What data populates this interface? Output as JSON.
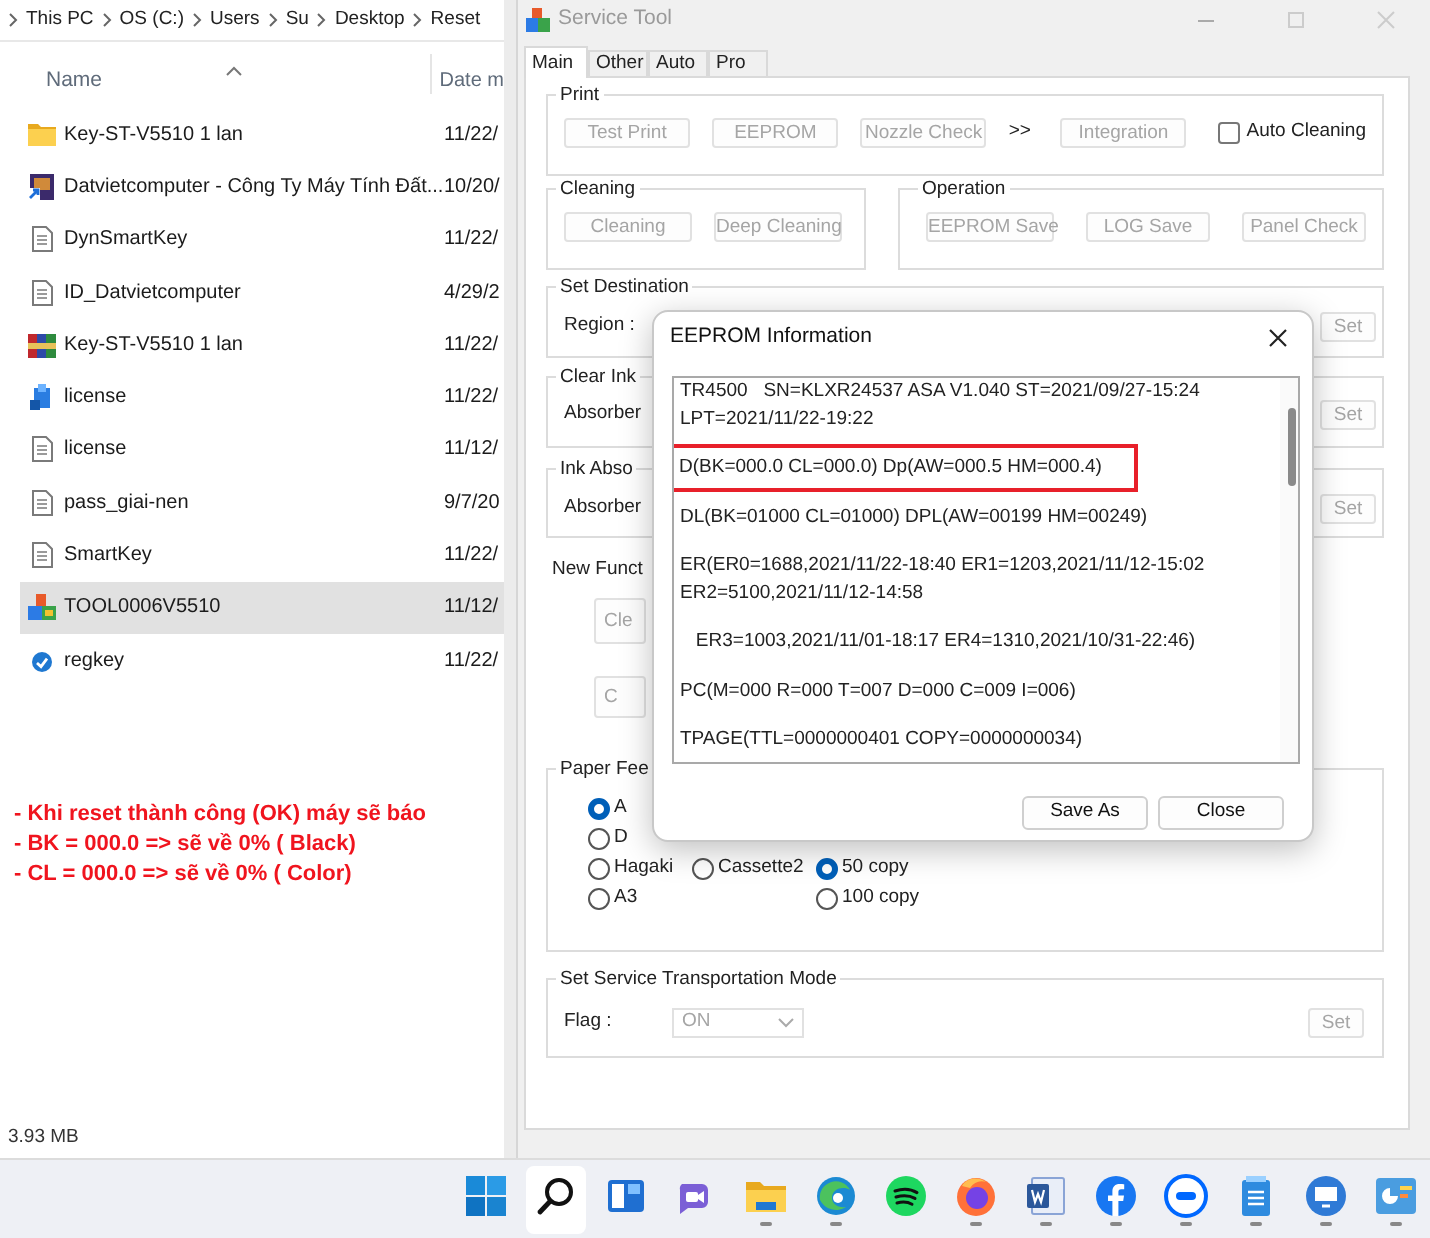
{
  "explorer": {
    "breadcrumb": [
      "This PC",
      "OS (C:)",
      "Users",
      "Su",
      "Desktop",
      "Reset"
    ],
    "columns": [
      "Name",
      "Date m"
    ],
    "files": [
      {
        "name": "Key-ST-V5510 1 lan",
        "date": "11/22/",
        "kind": "folder",
        "selected": false
      },
      {
        "name": "Datvietcomputer - Công Ty Máy Tính Đất...",
        "date": "10/20/",
        "kind": "shortcut",
        "selected": false
      },
      {
        "name": "DynSmartKey",
        "date": "11/22/",
        "kind": "text",
        "selected": false
      },
      {
        "name": "ID_Datvietcomputer",
        "date": "4/29/2",
        "kind": "text",
        "selected": false
      },
      {
        "name": "Key-ST-V5510 1 lan",
        "date": "11/22/",
        "kind": "archive",
        "selected": false
      },
      {
        "name": "license",
        "date": "11/22/",
        "kind": "setup",
        "selected": false
      },
      {
        "name": "license",
        "date": "11/12/",
        "kind": "text",
        "selected": false
      },
      {
        "name": "pass_giai-nen",
        "date": "9/7/20",
        "kind": "text",
        "selected": false
      },
      {
        "name": "SmartKey",
        "date": "11/22/",
        "kind": "text",
        "selected": false
      },
      {
        "name": "TOOL0006V5510",
        "date": "11/12/",
        "kind": "application",
        "selected": true
      },
      {
        "name": "regkey",
        "date": "11/22/",
        "kind": "registry",
        "selected": false
      }
    ],
    "status": "3.93 MB"
  },
  "note": [
    "- Khi reset thành công (OK) máy sẽ báo",
    "- BK = 000.0  => sẽ về 0%  ( Black)",
    "- CL = 000.0  => sẽ về 0% ( Color)"
  ],
  "service_tool": {
    "title": "Service Tool",
    "tabs": [
      {
        "label": "Main",
        "selected": true
      },
      {
        "label": "Other",
        "selected": false
      },
      {
        "label": "Auto",
        "selected": false
      },
      {
        "label": "Pro",
        "selected": false
      }
    ],
    "print": {
      "title": "Print",
      "items": [
        {
          "kind": "button",
          "label": "Test Print",
          "disabled": true
        },
        {
          "kind": "button",
          "label": "EEPROM",
          "disabled": true
        },
        {
          "kind": "button",
          "label": "Nozzle Check",
          "disabled": true
        },
        {
          "kind": "text",
          "label": ">>"
        },
        {
          "kind": "button",
          "label": "Integration",
          "disabled": true
        },
        {
          "kind": "checkbox",
          "label": "Auto Cleaning",
          "checked": false
        }
      ]
    },
    "cleaning": {
      "title": "Cleaning",
      "items": [
        {
          "kind": "button",
          "label": "Cleaning",
          "disabled": true
        },
        {
          "kind": "button",
          "label": "Deep Cleaning",
          "disabled": true
        }
      ]
    },
    "operation": {
      "title": "Operation",
      "items": [
        {
          "kind": "button",
          "label": "EEPROM Save",
          "disabled": true
        },
        {
          "kind": "button",
          "label": "LOG Save",
          "disabled": true
        },
        {
          "kind": "button",
          "label": "Panel Check",
          "disabled": true
        }
      ]
    },
    "set_rows": [
      {
        "title": "Set Destination",
        "label": "Region :",
        "button": "Set",
        "disabled": true
      },
      {
        "title": "Clear Ink",
        "label": "Absorber",
        "button": "Set",
        "disabled": true
      },
      {
        "title": "Ink Abso",
        "label": "Absorber",
        "button": "Set",
        "disabled": true
      }
    ],
    "new_function": {
      "title": "New Funct",
      "buttons": [
        {
          "label": "Cle",
          "disabled": true
        },
        {
          "label": "C",
          "disabled": true
        }
      ]
    },
    "paper_feed": {
      "title": "Paper Fee",
      "sources": [
        {
          "label": "A",
          "selected": true
        },
        {
          "label": "D",
          "selected": false
        },
        {
          "label": "Hagaki",
          "selected": false
        },
        {
          "label": "A3",
          "selected": false
        },
        {
          "label": "Cassette2",
          "selected": false
        }
      ],
      "copies": [
        {
          "label": "50 copy",
          "selected": true
        },
        {
          "label": "100 copy",
          "selected": false
        }
      ]
    },
    "transport": {
      "title": "Set Service Transportation Mode",
      "label": "Flag :",
      "value": "ON",
      "button": "Set",
      "disabled": true
    }
  },
  "dialog": {
    "title": "EEPROM Information",
    "lines": [
      {
        "text": "TR4500   SN=KLXR24537 ASA V1.040 ST=2021/09/27-15:24 LPT=2021/11/22-19:22",
        "highlighted": false
      },
      {
        "text": "D(BK=000.0 CL=000.0) Dp(AW=000.5 HM=000.4)",
        "highlighted": true
      },
      {
        "text": "DL(BK=01000 CL=01000) DPL(AW=00199 HM=00249)",
        "highlighted": false
      },
      {
        "text": "ER(ER0=1688,2021/11/22-18:40 ER1=1203,2021/11/12-15:02 ER2=5100,2021/11/12-14:58",
        "highlighted": false
      },
      {
        "text": "   ER3=1003,2021/11/01-18:17 ER4=1310,2021/10/31-22:46)",
        "highlighted": false
      },
      {
        "text": "PC(M=000 R=000 T=007 D=000 C=009 I=006)",
        "highlighted": false
      },
      {
        "text": "TPAGE(TTL=0000000401 COPY=0000000034)",
        "highlighted": false
      }
    ],
    "buttons": [
      "Save As",
      "Close"
    ]
  },
  "taskbar": {
    "apps": [
      {
        "kind": "start",
        "selected": false,
        "running": false
      },
      {
        "kind": "search",
        "selected": true,
        "running": false
      },
      {
        "kind": "widgets",
        "selected": false,
        "running": false
      },
      {
        "kind": "chat",
        "selected": false,
        "running": false
      },
      {
        "kind": "files",
        "selected": false,
        "running": true
      },
      {
        "kind": "edge",
        "selected": false,
        "running": true
      },
      {
        "kind": "spotify",
        "selected": false,
        "running": false
      },
      {
        "kind": "firefox",
        "selected": false,
        "running": true
      },
      {
        "kind": "word",
        "selected": false,
        "running": true
      },
      {
        "kind": "facebook",
        "selected": false,
        "running": true
      },
      {
        "kind": "zalo",
        "selected": false,
        "running": true
      },
      {
        "kind": "notepad",
        "selected": false,
        "running": true
      },
      {
        "kind": "remote",
        "selected": false,
        "running": true
      },
      {
        "kind": "chart",
        "selected": false,
        "running": true
      }
    ]
  }
}
